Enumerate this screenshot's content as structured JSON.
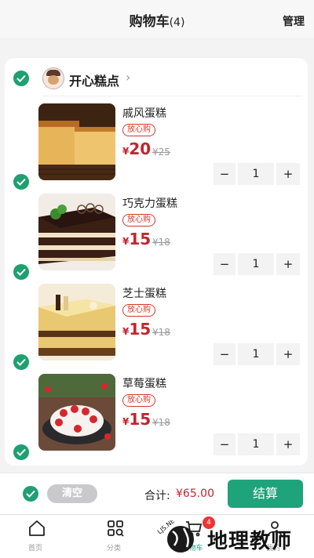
{
  "header": {
    "title": "购物车",
    "count": "(4)",
    "manage_label": "管理"
  },
  "shop": {
    "name": "开心糕点",
    "chevron": "›"
  },
  "items": [
    {
      "title": "戚风蛋糕",
      "tag": "放心购",
      "currency": "¥",
      "price": "20",
      "original_price": "¥25",
      "qty": "1",
      "minus": "−",
      "plus": "+"
    },
    {
      "title": "巧克力蛋糕",
      "tag": "放心购",
      "currency": "¥",
      "price": "15",
      "original_price": "¥18",
      "qty": "1",
      "minus": "−",
      "plus": "+"
    },
    {
      "title": "芝士蛋糕",
      "tag": "放心购",
      "currency": "¥",
      "price": "15",
      "original_price": "¥18",
      "qty": "1",
      "minus": "−",
      "plus": "+"
    },
    {
      "title": "草莓蛋糕",
      "tag": "放心购",
      "currency": "¥",
      "price": "15",
      "original_price": "¥18",
      "qty": "1",
      "minus": "−",
      "plus": "+"
    }
  ],
  "footer": {
    "clear_label": "清空",
    "total_label": "合计:",
    "total_value": "¥65.00",
    "checkout_label": "结算"
  },
  "tabs": [
    {
      "label": "首页",
      "icon": "home-icon"
    },
    {
      "label": "分类",
      "icon": "category-icon"
    },
    {
      "label": "购物车",
      "icon": "cart-icon",
      "badge": "4"
    },
    {
      "label": "我的",
      "icon": "user-icon"
    }
  ],
  "watermark": {
    "text": "地理教师",
    "logo_text": "LJS.NE"
  },
  "colors": {
    "accent": "#1fa37a",
    "price": "#c0262e",
    "tag": "#d03a2a"
  }
}
